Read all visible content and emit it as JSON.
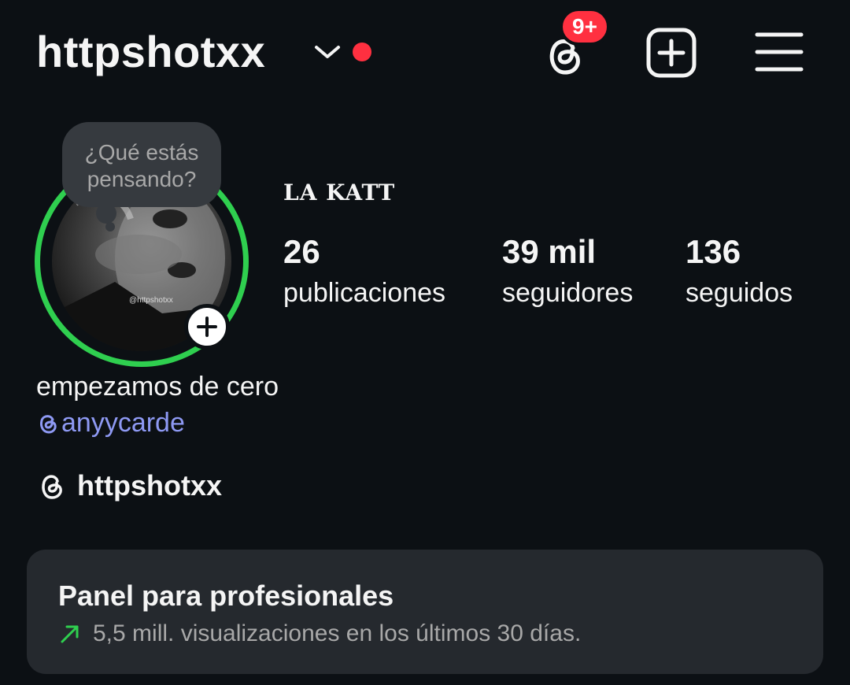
{
  "header": {
    "username": "httpshotxx",
    "notification_badge": "9+",
    "icons": [
      "chevron-down-icon",
      "threads-icon",
      "new-post-icon",
      "menu-icon"
    ]
  },
  "profile": {
    "note_placeholder": "¿Qué estás pensando?",
    "avatar_watermark": "@httpshotxx",
    "display_name": "LA KATT",
    "stats": [
      {
        "value": "26",
        "label": "publicaciones"
      },
      {
        "value": "39 mil",
        "label": "seguidores"
      },
      {
        "value": "136",
        "label": "seguidos"
      }
    ]
  },
  "bio": {
    "text": "empezamos de cero",
    "mention": "anyycarde",
    "threads_handle": "httpshotxx"
  },
  "dashboard": {
    "title": "Panel para profesionales",
    "subtitle": "5,5 mill. visualizaciones en los últimos 30 días."
  },
  "colors": {
    "background": "#0c1014",
    "story_ring": "#2fcf4f",
    "badge": "#ff3040",
    "mention": "#8e99f3",
    "trend_arrow": "#2fcf4f",
    "card": "#25292e"
  }
}
